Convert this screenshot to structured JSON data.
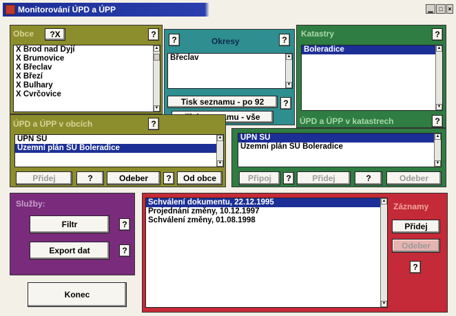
{
  "window": {
    "title": "Monitorování ÚPD a ÚPP"
  },
  "obce": {
    "label": "Obce",
    "toggle": "?X",
    "items": [
      "X Brod nad Dyjí",
      "X Brumovice",
      "X Břeclav",
      "X Březí",
      "X Bulhary",
      "X Cvrčovice"
    ]
  },
  "okresy": {
    "label": "Okresy",
    "items": [
      "Břeclav"
    ],
    "print_po92": "Tisk seznamu - po 92",
    "print_all": "Tisk seznamu - vše"
  },
  "katastry": {
    "label": "Katastry",
    "items": [
      "Boleradice"
    ]
  },
  "upd_obce": {
    "label": "ÚPD a ÚPP v obcích",
    "items": [
      "ÚPN SÚ",
      "Územní plán SÚ Boleradice"
    ],
    "btn_pridej": "Přidej",
    "btn_odeber": "Odeber",
    "btn_od_obce": "Od obce"
  },
  "upd_katastry": {
    "label": "ÚPD a ÚPP v katastrech",
    "items": [
      "ÚPN SÚ",
      "Územní plán SÚ Boleradice"
    ],
    "btn_pripoj": "Připoj",
    "btn_pridej": "Přidej",
    "btn_odeber": "Odeber"
  },
  "sluzby": {
    "label": "Služby:",
    "btn_filtr": "Filtr",
    "btn_export": "Export dat"
  },
  "zaznamy": {
    "label": "Záznamy",
    "items": [
      "Schválení dokumentu, 22.12.1995",
      "Projednání změny, 10.12.1997",
      "Schválení změny, 01.08.1998"
    ],
    "btn_pridej": "Přidej",
    "btn_odeber": "Odeber"
  },
  "konec": "Konec",
  "help": "?",
  "colors": {
    "olive": "#8c8d2c",
    "teal": "#2f8e8f",
    "green": "#2f7d42",
    "purple": "#7a2b7c",
    "red": "#c42a37",
    "selection": "#1c2f96"
  }
}
